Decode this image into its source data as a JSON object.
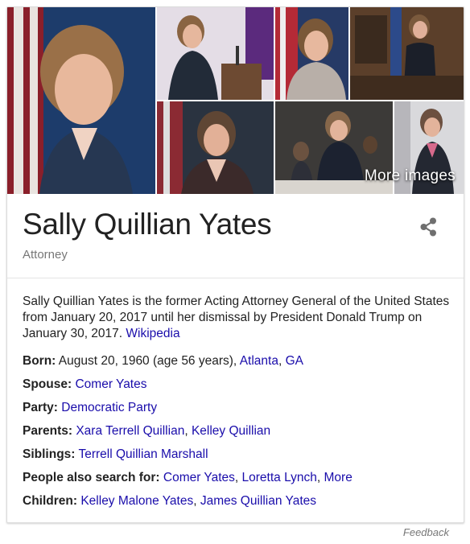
{
  "images": {
    "more_label": "More images"
  },
  "entity": {
    "name": "Sally Quillian Yates",
    "type": "Attorney",
    "description": "Sally Quillian Yates is the former Acting Attorney General of the United States from January 20, 2017 until her dismissal by President Donald Trump on January 30, 2017.",
    "source_link": "Wikipedia"
  },
  "facts": {
    "born": {
      "label": "Born:",
      "text": "August 20, 1960 (age 56 years),",
      "link1": "Atlanta",
      "sep": ",",
      "link2": "GA"
    },
    "spouse": {
      "label": "Spouse:",
      "link1": "Comer Yates"
    },
    "party": {
      "label": "Party:",
      "link1": "Democratic Party"
    },
    "parents": {
      "label": "Parents:",
      "link1": "Xara Terrell Quillian",
      "sep": ",",
      "link2": "Kelley Quillian"
    },
    "siblings": {
      "label": "Siblings:",
      "link1": "Terrell Quillian Marshall"
    },
    "people": {
      "label": "People also search for:",
      "link1": "Comer Yates",
      "sep1": ",",
      "link2": "Loretta Lynch",
      "sep2": ",",
      "link3": "More"
    },
    "children": {
      "label": "Children:",
      "link1": "Kelley Malone Yates",
      "sep": ",",
      "link2": "James Quillian Yates"
    }
  },
  "footer": {
    "feedback": "Feedback"
  }
}
